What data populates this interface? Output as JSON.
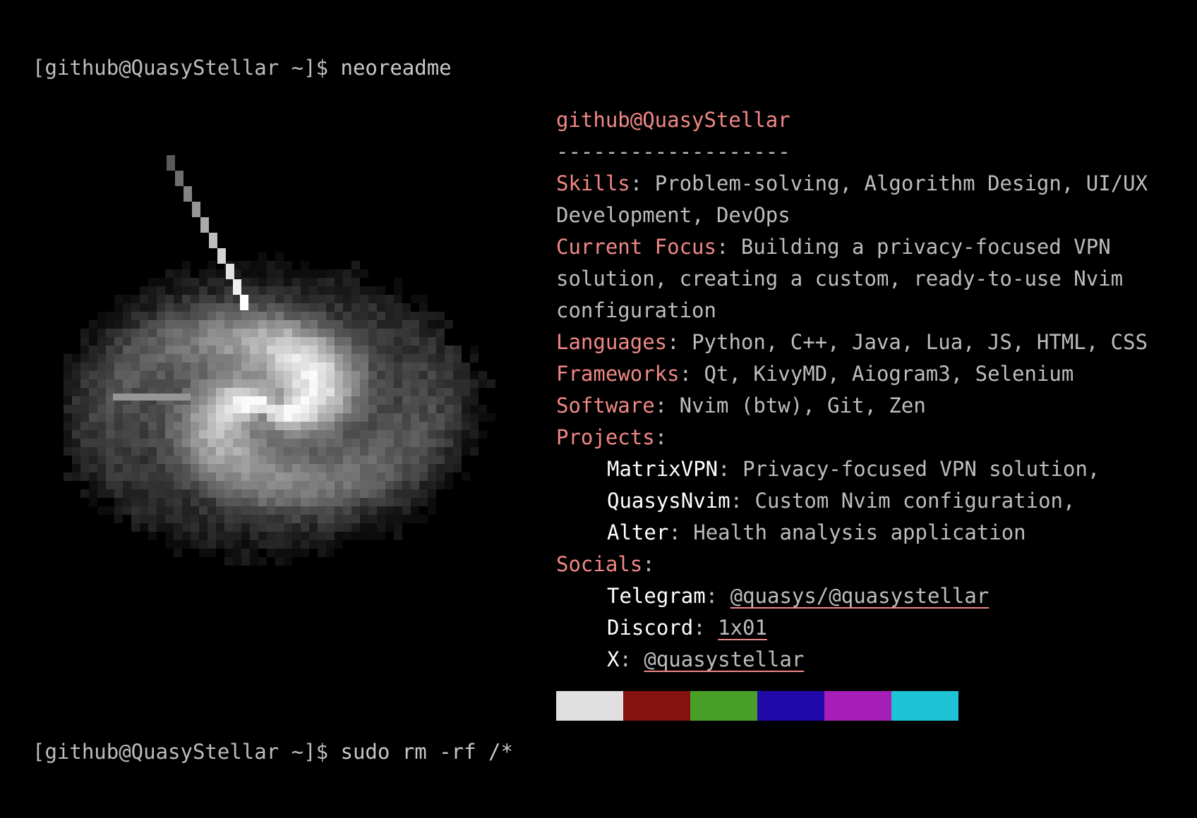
{
  "terminal": {
    "prompt": "[github@QuasyStellar ~]$",
    "commands": [
      "neoreadme",
      "sudo rm -rf /*"
    ]
  },
  "info": {
    "user_host": "github@QuasyStellar",
    "separator": "-------------------",
    "fields": [
      {
        "key": "Skills",
        "value": "Problem-solving, Algorithm Design, UI/UX Development, DevOps"
      },
      {
        "key": "Current Focus",
        "value": "Building a privacy-focused VPN solution, creating a custom, ready-to-use Nvim configuration"
      },
      {
        "key": "Languages",
        "value": "Python, C++, Java, Lua, JS, HTML, CSS"
      },
      {
        "key": "Frameworks",
        "value": "Qt, KivyMD, Aiogram3, Selenium"
      },
      {
        "key": "Software",
        "value": "Nvim (btw), Git, Zen"
      }
    ],
    "projects": {
      "key": "Projects",
      "items": [
        {
          "name": "MatrixVPN",
          "desc": "Privacy-focused VPN solution,"
        },
        {
          "name": "QuasysNvim",
          "desc": "Custom Nvim configuration,"
        },
        {
          "name": "Alter",
          "desc": "Health analysis application"
        }
      ]
    },
    "socials": {
      "key": "Socials",
      "items": [
        {
          "name": "Telegram",
          "handle": "@quasys/@quasystellar"
        },
        {
          "name": "Discord",
          "handle": "1x01"
        },
        {
          "name": "X",
          "handle": "@quasystellar"
        }
      ]
    },
    "palette": [
      "#e0e0e0",
      "#861111",
      "#48a028",
      "#2108a8",
      "#a61db8",
      "#1ec4d6"
    ]
  },
  "icons": {
    "art": "pixel-comet-galaxy-image"
  }
}
